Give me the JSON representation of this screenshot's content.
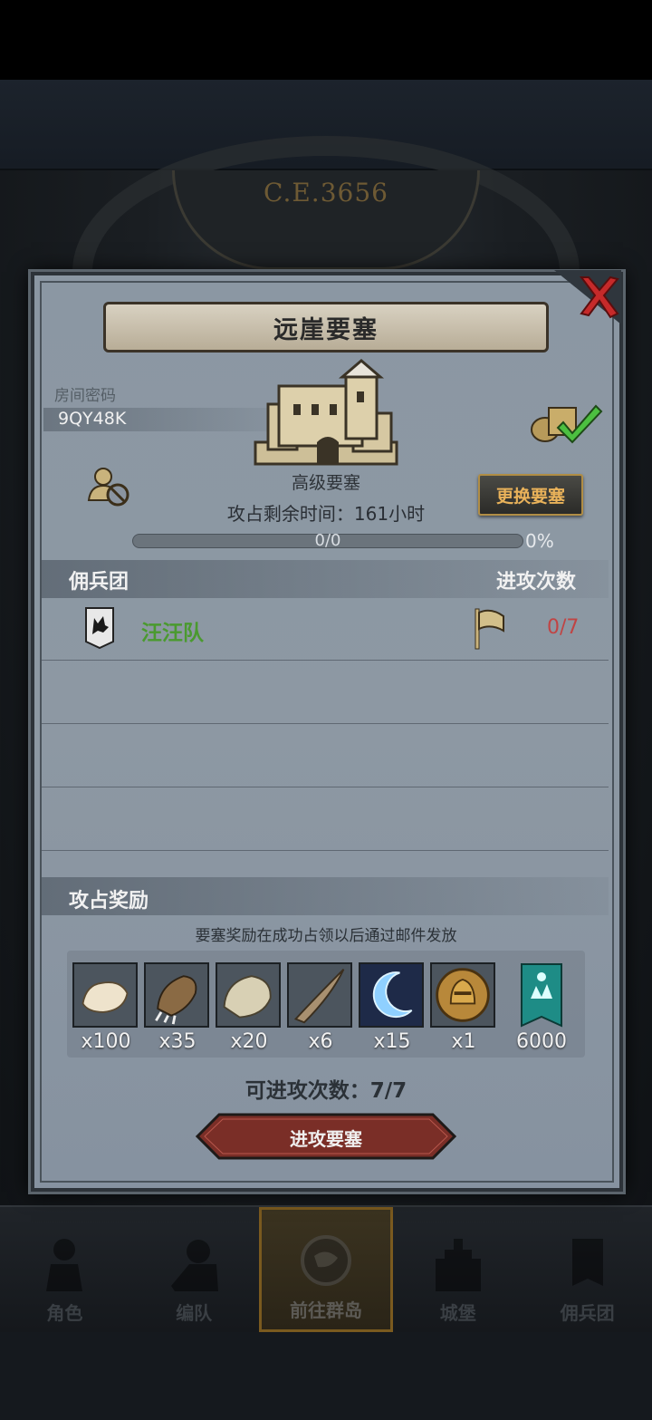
{
  "era_label": "C.E.3656",
  "modal": {
    "title": "远崖要塞",
    "room_label": "房间密码",
    "room_code": "9QY48K",
    "fortress_type": "高级要塞",
    "swap_button": "更换要塞",
    "time_remaining": "攻占剩余时间：161小时",
    "progress": {
      "text": "0/0",
      "percent_label": "0%",
      "fraction": 0
    },
    "mercenary_header": "佣兵团",
    "attacks_header": "进攻次数",
    "mercenaries": [
      {
        "name": "汪汪队",
        "attacks": "0/7"
      }
    ],
    "rewards_header": "攻占奖励",
    "rewards_note": "要塞奖励在成功占领以后通过邮件发放",
    "rewards": [
      {
        "icon": "white-fur-icon",
        "qty": "x100"
      },
      {
        "icon": "beast-claw-icon",
        "qty": "x35"
      },
      {
        "icon": "pale-hide-icon",
        "qty": "x20"
      },
      {
        "icon": "horn-icon",
        "qty": "x6"
      },
      {
        "icon": "crescent-moon-icon",
        "qty": "x15"
      },
      {
        "icon": "knight-medal-icon",
        "qty": "x1"
      },
      {
        "icon": "guild-banner-icon",
        "qty": "6000"
      }
    ],
    "attack_count": "可进攻次数：7/7",
    "attack_button": "进攻要塞"
  },
  "bottom_nav": [
    {
      "label": "角色",
      "icon": "character-icon"
    },
    {
      "label": "编队",
      "icon": "formation-icon"
    },
    {
      "label": "前往群岛",
      "icon": "globe-icon",
      "active": true
    },
    {
      "label": "城堡",
      "icon": "castle-icon"
    },
    {
      "label": "佣兵团",
      "icon": "mercenary-icon"
    }
  ],
  "colors": {
    "accent_gold": "#e9b25a",
    "mercenary_name": "#4a9a2f",
    "attack_count_red": "#c04444",
    "attack_button": "#7a2e27"
  }
}
